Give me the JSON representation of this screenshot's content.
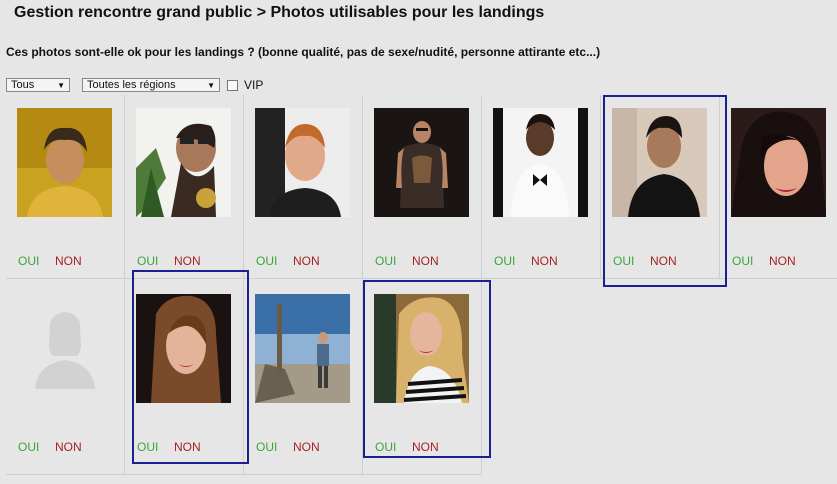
{
  "page": {
    "title": "Gestion rencontre grand public > Photos utilisables pour les landings",
    "question": "Ces photos sont-elle ok pour les landings ? (bonne qualité, pas de sexe/nudité, personne attirante etc...)"
  },
  "filters": {
    "type_select": "Tous",
    "region_select": "Toutes les régions",
    "vip_label": "VIP"
  },
  "actions": {
    "yes_label": "OUI",
    "no_label": "NON"
  },
  "photos": [
    {
      "subject": "man-curly-hair-yellow"
    },
    {
      "subject": "man-sunglasses-watch"
    },
    {
      "subject": "man-red-hair"
    },
    {
      "subject": "man-tank-top"
    },
    {
      "subject": "man-bow-tie"
    },
    {
      "subject": "young-man-dark"
    },
    {
      "subject": "woman-dark-hair"
    },
    {
      "subject": "placeholder-silhouette"
    },
    {
      "subject": "woman-long-hair"
    },
    {
      "subject": "man-outdoor-rocks"
    },
    {
      "subject": "woman-blonde-striped"
    }
  ]
}
